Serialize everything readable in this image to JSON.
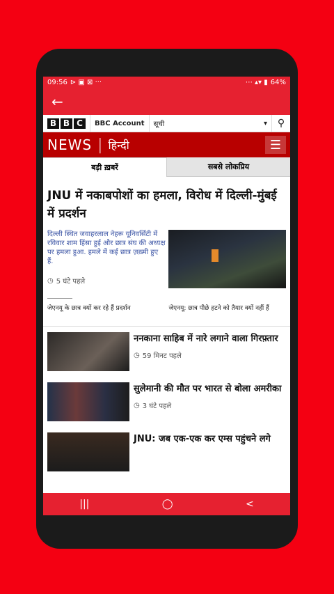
{
  "status": {
    "time": "09:56",
    "battery": "64%",
    "left_icons": "⊳ ▣ ⊠ ···",
    "right_icons": "⋯ ▴▾ ▮"
  },
  "bbc": {
    "logo": [
      "B",
      "B",
      "C"
    ],
    "account": "BBC Account",
    "menu": "सूची",
    "menu_arrow": "▾"
  },
  "news": {
    "news": "NEWS",
    "sep": "|",
    "language": "हिन्दी"
  },
  "tabs": [
    {
      "label": "बड़ी ख़बरें"
    },
    {
      "label": "सबसे लोकप्रिय"
    }
  ],
  "lead": {
    "headline": "JNU में नकाबपोशों का हमला, विरोध में दिल्ली-मुंबई में प्रदर्शन",
    "summary": "दिल्ली स्थित जवाहरलाल नेहरू यूनिवर्सिटी में रविवार शाम हिंसा हुई और छात्र संघ की अध्यक्ष पर हमला हुआ. हमले में कई छात्र ज़ख़्मी हुए हैं.",
    "time": "5 घंटे पहले",
    "related": [
      "जेएनयू के छात्र क्यों कर रहे हैं प्रदर्शन",
      "जेएनयू: छात्र पीछे हटने को तैयार क्यों नहीं हैं"
    ]
  },
  "items": [
    {
      "title": "ननकाना साहिब में नारे लगाने वाला गिरफ़्तार",
      "time": "59 मिनट पहले"
    },
    {
      "title": "सुलेमानी की मौत पर भारत से बोला अमरीका",
      "time": "3 घंटे पहले"
    },
    {
      "title": "JNU: जब एक-एक कर एम्स पहुंचने लगे",
      "time": ""
    }
  ],
  "nav": {
    "recent": "|||",
    "home": "◯",
    "back": "<"
  },
  "icons": {
    "back": "arrow-left",
    "search": "search",
    "menu": "hamburger",
    "clock": "clock"
  },
  "colors": {
    "brand_red": "#e62130",
    "news_red": "#b80000",
    "link_blue": "#3a53a4"
  }
}
